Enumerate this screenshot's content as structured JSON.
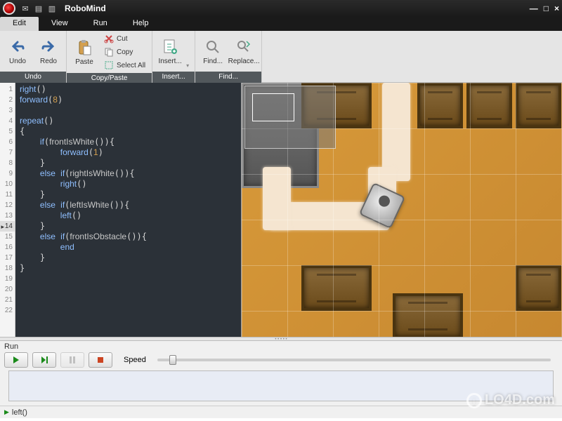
{
  "titlebar": {
    "app_name": "RoboMind",
    "min": "—",
    "max": "□",
    "close": "×"
  },
  "menu": {
    "items": [
      "Edit",
      "View",
      "Run",
      "Help"
    ],
    "active_index": 0
  },
  "ribbon": {
    "undo": "Undo",
    "redo": "Redo",
    "paste": "Paste",
    "cut": "Cut",
    "copy": "Copy",
    "select_all": "Select All",
    "insert": "Insert...",
    "find": "Find...",
    "replace": "Replace...",
    "group_undo": "Undo",
    "group_copy": "Copy/Paste",
    "group_insert": "Insert...",
    "group_find": "Find..."
  },
  "editor": {
    "line_count": 22,
    "current_line": 14,
    "code_lines": [
      "right()",
      "forward(8)",
      "",
      "repeat()",
      "{",
      "    if(frontIsWhite()){",
      "        forward(1)",
      "    }",
      "    else if(rightIsWhite()){",
      "        right()",
      "    }",
      "    else if(leftIsWhite()){",
      "        left()",
      "    }",
      "    else if(frontIsObstacle()){",
      "        end",
      "    }",
      "}",
      "",
      "",
      "",
      ""
    ]
  },
  "run": {
    "label": "Run",
    "speed_label": "Speed"
  },
  "status": {
    "text": "left()"
  },
  "watermark": "LO4D.com"
}
